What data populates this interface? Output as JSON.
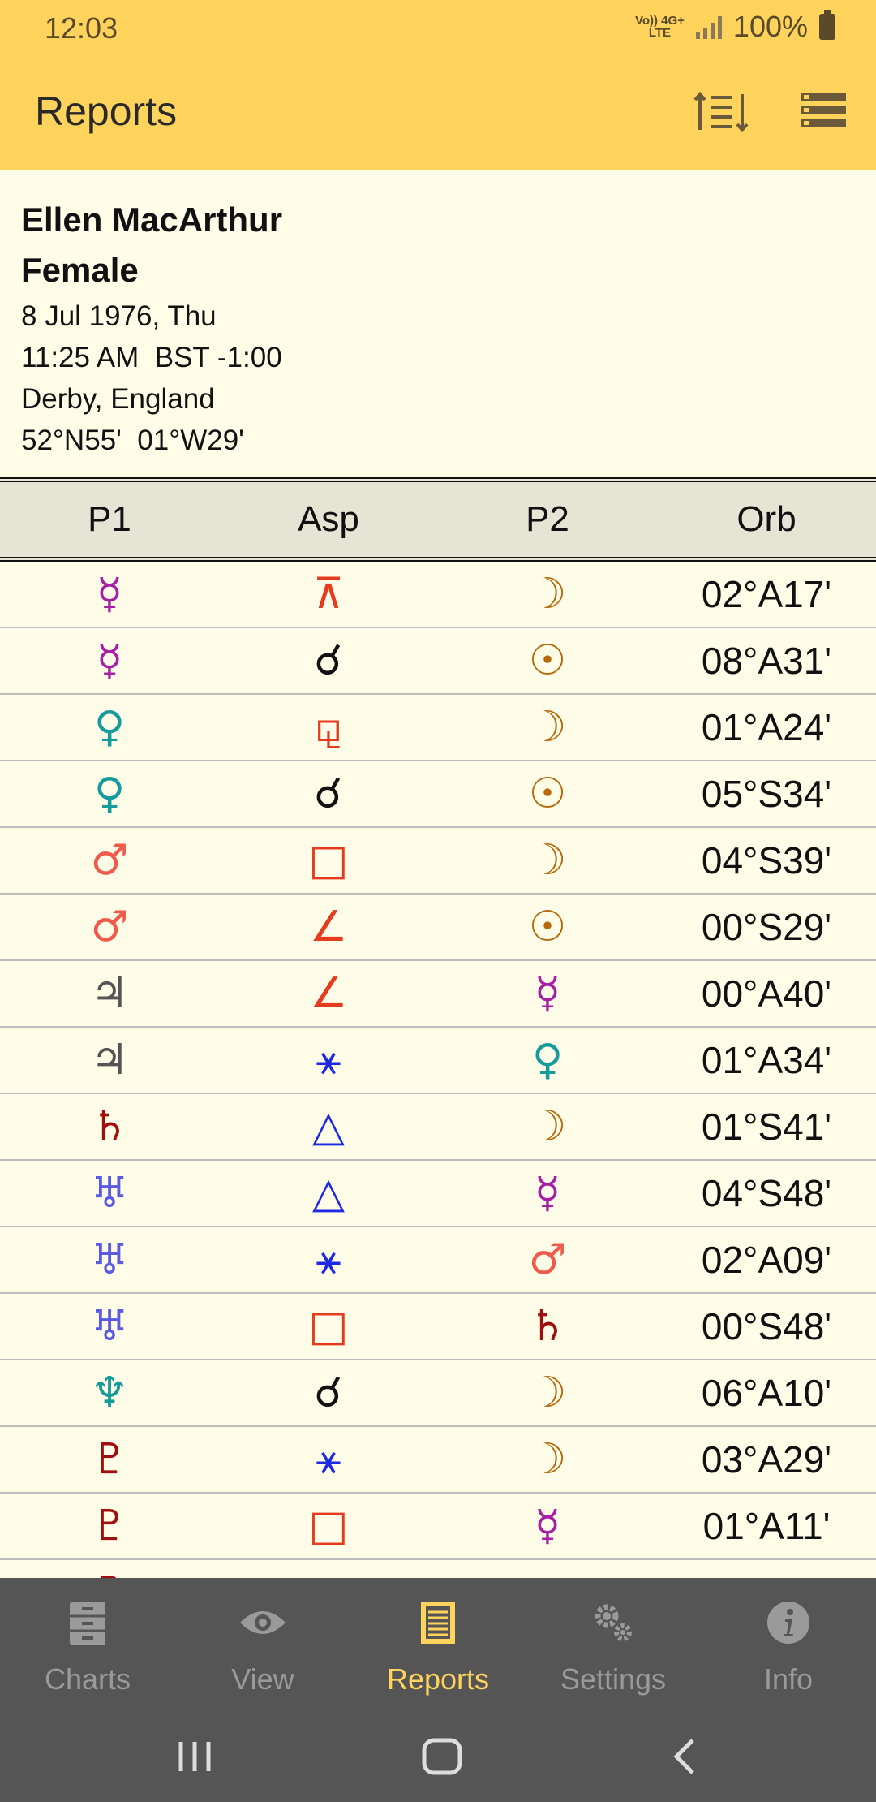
{
  "status": {
    "time": "12:03",
    "network_top": "Vo)) 4G+",
    "network_bottom": "LTE",
    "battery": "100%"
  },
  "appbar": {
    "title": "Reports"
  },
  "chart_info": {
    "name": "Ellen MacArthur",
    "gender": "Female",
    "date": "8 Jul 1976, Thu",
    "time": "11:25 AM  BST -1:00",
    "place": "Derby, England",
    "coords": "52°N55'  01°W29'"
  },
  "table": {
    "headers": [
      "P1",
      "Asp",
      "P2",
      "Orb"
    ],
    "rows": [
      {
        "p1": "☿",
        "p1c": "#a61fa6",
        "asp": "⊼",
        "aspc": "#e53b1e",
        "p2": "☽",
        "p2c": "#b8680a",
        "orb": "02°A17'"
      },
      {
        "p1": "☿",
        "p1c": "#a61fa6",
        "asp": "☌",
        "aspc": "#111111",
        "p2": "☉",
        "p2c": "#b8680a",
        "orb": "08°A31'"
      },
      {
        "p1": "♀",
        "p1c": "#159b9b",
        "asp": "⚼",
        "aspc": "#e53b1e",
        "p2": "☽",
        "p2c": "#b8680a",
        "orb": "01°A24'"
      },
      {
        "p1": "♀",
        "p1c": "#159b9b",
        "asp": "☌",
        "aspc": "#111111",
        "p2": "☉",
        "p2c": "#b8680a",
        "orb": "05°S34'"
      },
      {
        "p1": "♂",
        "p1c": "#ef5a4a",
        "asp": "□",
        "aspc": "#e53b1e",
        "p2": "☽",
        "p2c": "#b8680a",
        "orb": "04°S39'"
      },
      {
        "p1": "♂",
        "p1c": "#ef5a4a",
        "asp": "∠",
        "aspc": "#e53b1e",
        "p2": "☉",
        "p2c": "#b8680a",
        "orb": "00°S29'"
      },
      {
        "p1": "♃",
        "p1c": "#555555",
        "asp": "∠",
        "aspc": "#e53b1e",
        "p2": "☿",
        "p2c": "#a61fa6",
        "orb": "00°A40'"
      },
      {
        "p1": "♃",
        "p1c": "#555555",
        "asp": "⚹",
        "aspc": "#1c28e6",
        "p2": "♀",
        "p2c": "#159b9b",
        "orb": "01°A34'"
      },
      {
        "p1": "♄",
        "p1c": "#a00e0e",
        "asp": "△",
        "aspc": "#1c28e6",
        "p2": "☽",
        "p2c": "#b8680a",
        "orb": "01°S41'"
      },
      {
        "p1": "♅",
        "p1c": "#5a5ae6",
        "asp": "△",
        "aspc": "#1c28e6",
        "p2": "☿",
        "p2c": "#a61fa6",
        "orb": "04°S48'"
      },
      {
        "p1": "♅",
        "p1c": "#5a5ae6",
        "asp": "⚹",
        "aspc": "#1c28e6",
        "p2": "♂",
        "p2c": "#ef5a4a",
        "orb": "02°A09'"
      },
      {
        "p1": "♅",
        "p1c": "#5a5ae6",
        "asp": "□",
        "aspc": "#e53b1e",
        "p2": "♄",
        "p2c": "#a00e0e",
        "orb": "00°S48'"
      },
      {
        "p1": "♆",
        "p1c": "#159b9b",
        "asp": "☌",
        "aspc": "#111111",
        "p2": "☽",
        "p2c": "#b8680a",
        "orb": "06°A10'"
      },
      {
        "p1": "♇",
        "p1c": "#a00e0e",
        "asp": "⚹",
        "aspc": "#1c28e6",
        "p2": "☽",
        "p2c": "#b8680a",
        "orb": "03°A29'"
      },
      {
        "p1": "♇",
        "p1c": "#a00e0e",
        "asp": "□",
        "aspc": "#e53b1e",
        "p2": "☿",
        "p2c": "#a61fa6",
        "orb": "01°A11'"
      },
      {
        "p1": "♇",
        "p1c": "#a00e0e",
        "asp": "□",
        "aspc": "#e53b1e",
        "p2": "",
        "p2c": "#b8680a",
        "orb": ""
      }
    ]
  },
  "bottom_nav": {
    "items": [
      {
        "label": "Charts",
        "icon": "cabinet-icon"
      },
      {
        "label": "View",
        "icon": "eye-icon"
      },
      {
        "label": "Reports",
        "icon": "report-icon"
      },
      {
        "label": "Settings",
        "icon": "gears-icon"
      },
      {
        "label": "Info",
        "icon": "info-icon"
      }
    ],
    "active": "Reports"
  },
  "colors": {
    "accent": "#FFD35C",
    "background": "#FFFDE7",
    "nav_bg": "#555555",
    "header_row_bg": "#E6E4D4"
  }
}
